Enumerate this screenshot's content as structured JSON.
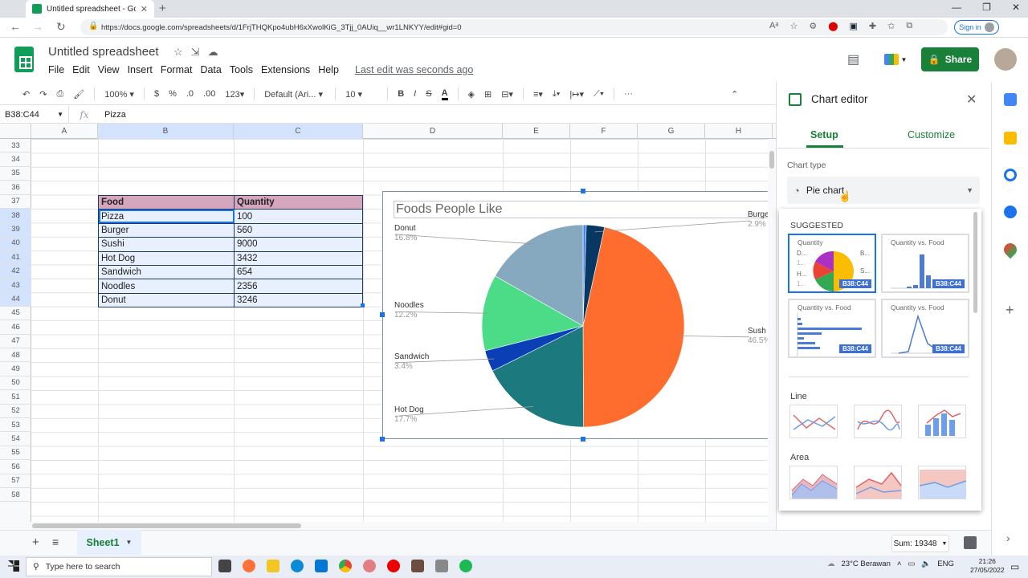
{
  "browser": {
    "tab_title": "Untitled spreadsheet - Google S",
    "url": "https://docs.google.com/spreadsheets/d/1FrjTHQKpo4ubH6xXwolKiG_3Tjj_0AUiq__wr1LNKYY/edit#gid=0",
    "sign_in": "Sign in"
  },
  "doc": {
    "title": "Untitled spreadsheet",
    "menus": [
      "File",
      "Edit",
      "View",
      "Insert",
      "Format",
      "Data",
      "Tools",
      "Extensions",
      "Help"
    ],
    "last_edit": "Last edit was seconds ago",
    "share_label": "Share"
  },
  "toolbar": {
    "zoom": "100%",
    "currency": "$",
    "percent": "%",
    "dec_less": ".0",
    "dec_more": ".00",
    "format_more": "123",
    "font": "Default (Ari...",
    "font_size": "10",
    "bold": "B",
    "italic": "I",
    "strike": "S",
    "text_color": "A"
  },
  "formula_bar": {
    "name_box": "B38:C44",
    "fx": "fx",
    "value": "Pizza"
  },
  "grid": {
    "columns": [
      "A",
      "B",
      "C",
      "D",
      "E",
      "F",
      "G",
      "H"
    ],
    "rows": [
      "33",
      "34",
      "35",
      "36",
      "37",
      "38",
      "39",
      "40",
      "41",
      "42",
      "43",
      "44",
      "45",
      "46",
      "47",
      "48",
      "49",
      "50",
      "51",
      "52",
      "53",
      "54",
      "55",
      "56",
      "57",
      "58"
    ]
  },
  "table": {
    "headers": [
      "Food",
      "Quantity"
    ],
    "rows": [
      [
        "Pizza",
        "100"
      ],
      [
        "Burger",
        "560"
      ],
      [
        "Sushi",
        "9000"
      ],
      [
        "Hot Dog",
        "3432"
      ],
      [
        "Sandwich",
        "654"
      ],
      [
        "Noodles",
        "2356"
      ],
      [
        "Donut",
        "3246"
      ]
    ]
  },
  "chart_data": {
    "type": "pie",
    "title": "Foods People Like",
    "categories": [
      "Pizza",
      "Burger",
      "Sushi",
      "Hot Dog",
      "Sandwich",
      "Noodles",
      "Donut"
    ],
    "values": [
      100,
      560,
      9000,
      3432,
      654,
      2356,
      3246
    ],
    "colors": [
      "#4285f4",
      "#073763",
      "#ff6d2e",
      "#1c7a7e",
      "#0b3fb5",
      "#4cdb86",
      "#86a9bf"
    ],
    "labels": [
      {
        "name": "Burge",
        "pct": "2.9%"
      },
      {
        "name": "Sush",
        "pct": "46.5%"
      },
      {
        "name": "Hot Dog",
        "pct": "17.7%"
      },
      {
        "name": "Sandwich",
        "pct": "3.4%"
      },
      {
        "name": "Noodles",
        "pct": "12.2%"
      },
      {
        "name": "Donut",
        "pct": "16.8%"
      }
    ]
  },
  "sheet": {
    "tab": "Sheet1",
    "sum": "Sum: 19348"
  },
  "editor": {
    "title": "Chart editor",
    "tab_setup": "Setup",
    "tab_customize": "Customize",
    "chart_type_label": "Chart type",
    "chart_type_value": "Pie chart",
    "suggested": "SUGGESTED",
    "thumb_labels": [
      "Quantity",
      "Quantity vs. Food",
      "Quantity vs. Food",
      "Quantity vs. Food"
    ],
    "pie_thumb_letters": [
      "D...",
      "1...",
      "H...",
      "1...",
      "B...",
      "S...",
      "S..."
    ],
    "range_badge": "B38:C44",
    "section_line": "Line",
    "section_area": "Area"
  },
  "taskbar": {
    "search": "Type here to search",
    "weather": "23°C  Berawan",
    "time": "21:26",
    "date": "27/05/2022"
  }
}
